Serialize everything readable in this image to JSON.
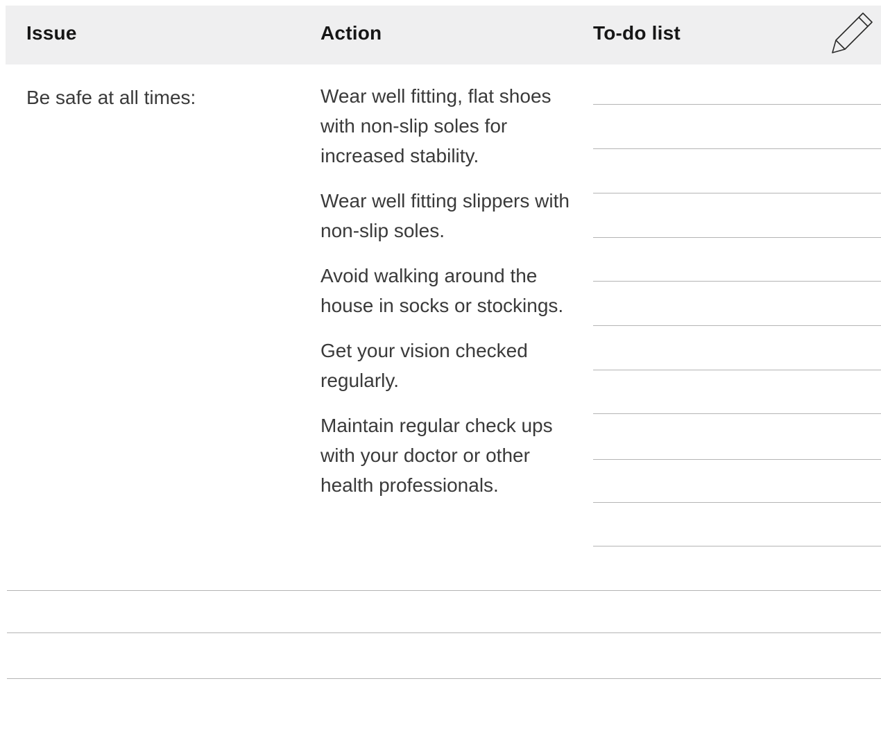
{
  "header": {
    "issue_label": "Issue",
    "action_label": "Action",
    "todo_label": "To-do list",
    "edit_icon": "pencil-icon",
    "background_color": "#efeff0"
  },
  "issue": {
    "text": "Be safe at all times:"
  },
  "actions": [
    "Wear well fitting, flat shoes with non-slip soles for increased stability.",
    "Wear well fitting slippers with non-slip soles.",
    "Avoid walking around the house in socks or stockings.",
    "Get your vision checked regularly.",
    "Maintain regular check ups with your doctor or other health professionals."
  ],
  "todo_list": {
    "blank_line_count": 11
  },
  "notes": {
    "blank_line_count": 3
  }
}
